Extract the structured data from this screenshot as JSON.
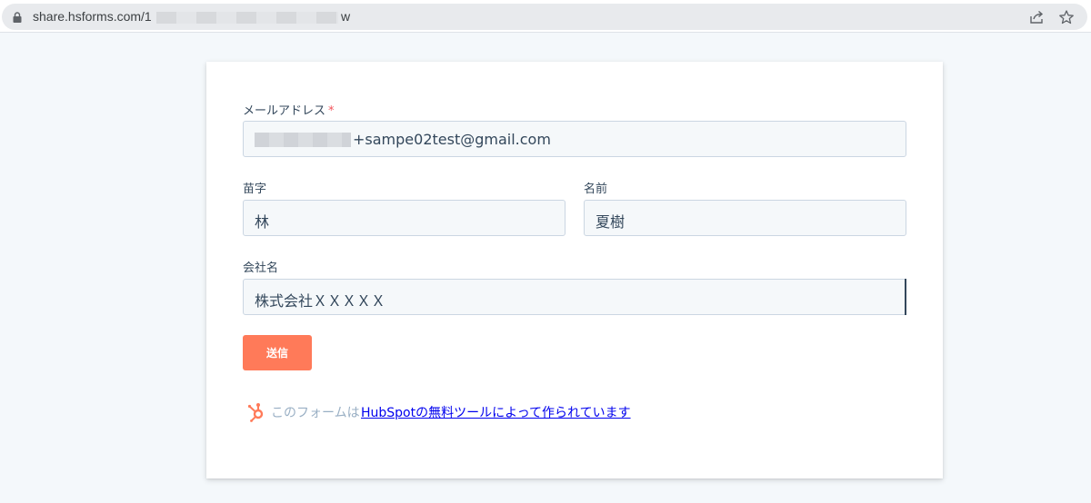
{
  "browser": {
    "url_visible": "share.hsforms.com/1",
    "url_tail": "w",
    "lock_icon": "lock-icon",
    "share_icon": "share-icon",
    "bookmark_icon": "star-icon"
  },
  "form": {
    "email": {
      "label": "メールアドレス",
      "required_mark": "*",
      "value": "+sampe02test@gmail.com"
    },
    "last_name": {
      "label": "苗字",
      "value": "林"
    },
    "first_name": {
      "label": "名前",
      "value": "夏樹"
    },
    "company": {
      "label": "会社名",
      "value": "株式会社ＸＸＸＸＸ"
    },
    "submit_label": "送信"
  },
  "branding": {
    "prefix": "このフォームは",
    "link_text": "HubSpotの無料ツールによって作られています",
    "icon": "hubspot-sprocket-icon"
  },
  "colors": {
    "button": "#ff7a59",
    "required": "#f2545b",
    "label_text": "#33475b",
    "field_bg": "#f5f8fa",
    "link": "#0000ee"
  }
}
